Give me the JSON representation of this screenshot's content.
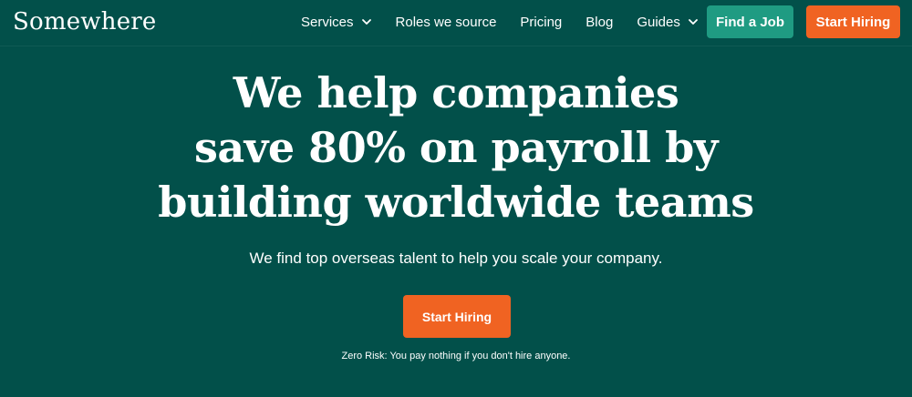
{
  "brand": {
    "name": "Somewhere"
  },
  "nav": {
    "items": [
      {
        "label": "Services",
        "has_dropdown": true
      },
      {
        "label": "Roles we source",
        "has_dropdown": false
      },
      {
        "label": "Pricing",
        "has_dropdown": false
      },
      {
        "label": "Blog",
        "has_dropdown": false
      },
      {
        "label": "Guides",
        "has_dropdown": true
      }
    ],
    "find_job_label": "Find a Job",
    "start_hiring_label": "Start Hiring"
  },
  "hero": {
    "title_lines": [
      "We help companies",
      "save 80% on payroll by",
      "building worldwide teams"
    ],
    "subtitle": "We find top overseas talent to help you scale your company.",
    "cta_label": "Start Hiring",
    "note": "Zero Risk: You pay nothing if you don't hire anyone."
  },
  "colors": {
    "background": "#02504a",
    "find_job_button": "#1f9b82",
    "start_hiring_button": "#f06322",
    "text": "#ffffff"
  }
}
